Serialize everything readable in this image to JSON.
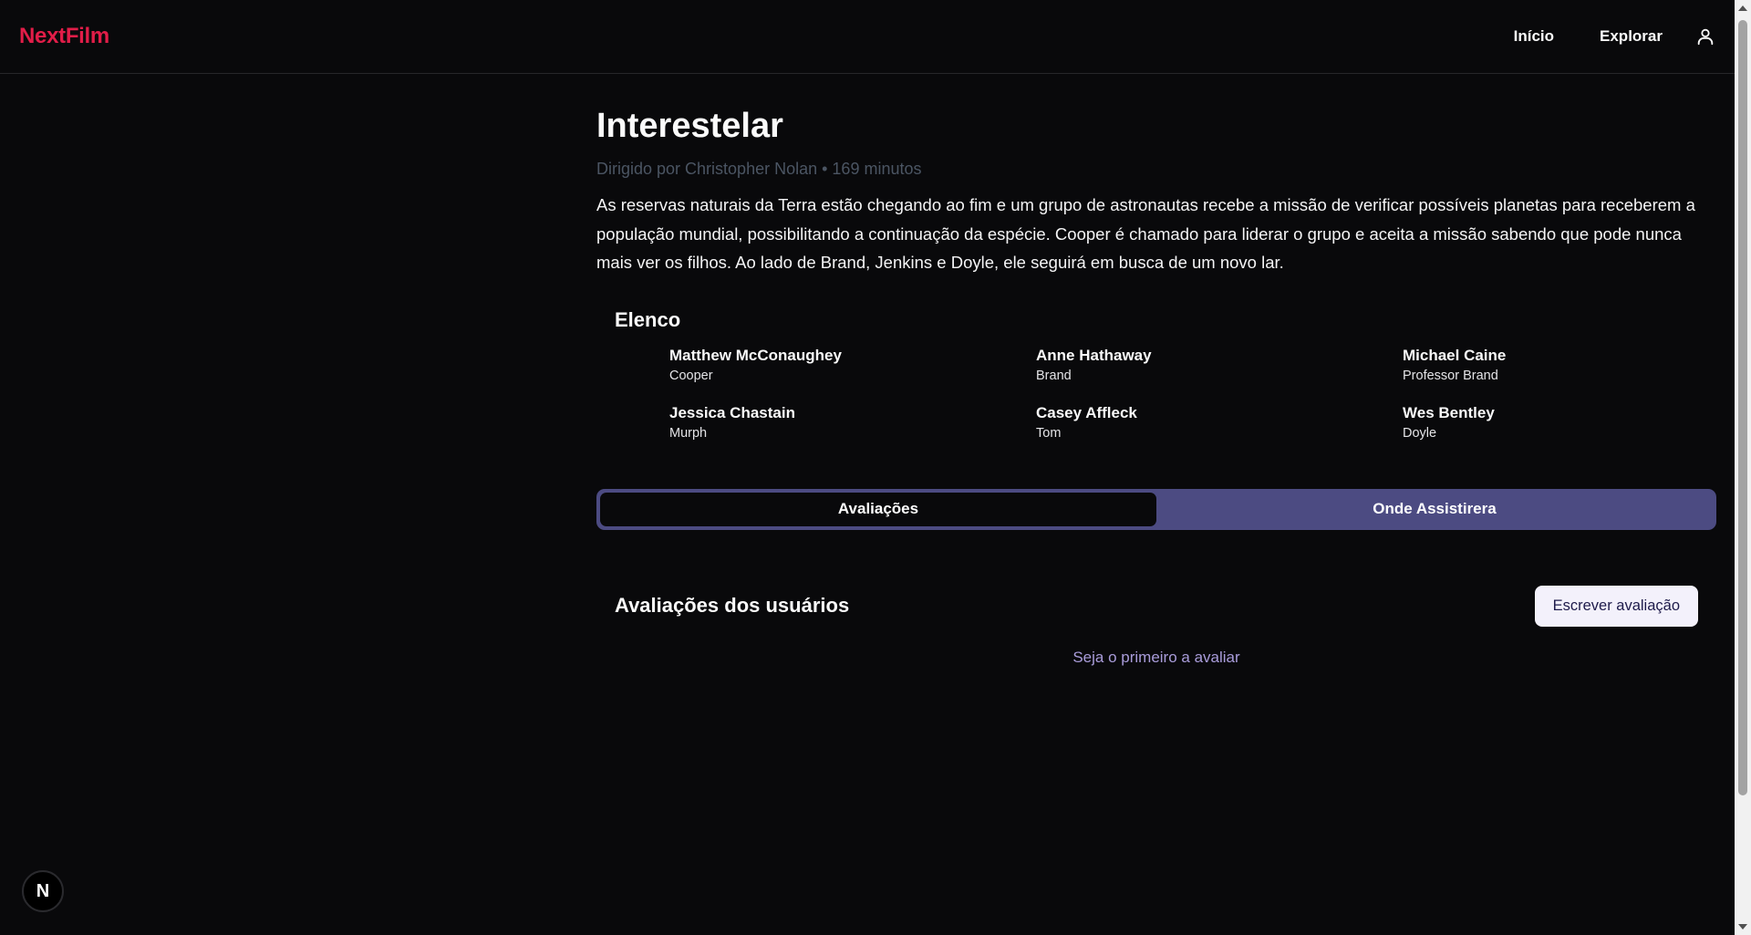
{
  "header": {
    "logo": "NextFilm",
    "nav": [
      {
        "label": "Início"
      },
      {
        "label": "Explorar"
      }
    ],
    "user_icon": "user-icon"
  },
  "movie": {
    "title": "Interestelar",
    "subtitle": "Dirigido por Christopher Nolan • 169 minutos",
    "synopsis": "As reservas naturais da Terra estão chegando ao fim e um grupo de astronautas recebe a missão de verificar possíveis planetas para receberem a população mundial, possibilitando a continuação da espécie. Cooper é chamado para liderar o grupo e aceita a missão sabendo que pode nunca mais ver os filhos. Ao lado de Brand, Jenkins e Doyle, ele seguirá em busca de um novo lar."
  },
  "cast": {
    "title": "Elenco",
    "members": [
      {
        "name": "Matthew McConaughey",
        "role": "Cooper"
      },
      {
        "name": "Anne Hathaway",
        "role": "Brand"
      },
      {
        "name": "Michael Caine",
        "role": "Professor Brand"
      },
      {
        "name": "Jessica Chastain",
        "role": "Murph"
      },
      {
        "name": "Casey Affleck",
        "role": "Tom"
      },
      {
        "name": "Wes Bentley",
        "role": "Doyle"
      }
    ]
  },
  "tabs": [
    {
      "label": "Avaliações",
      "active": true
    },
    {
      "label": "Onde Assistirera",
      "active": false
    }
  ],
  "reviews": {
    "title": "Avaliações dos usuários",
    "write_button": "Escrever avaliação",
    "empty_message": "Seja o primeiro a avaliar"
  },
  "badge": {
    "label": "N"
  },
  "colors": {
    "background": "#09090b",
    "brand": "#e11d48",
    "tabs_bg": "#4c4b82",
    "button_bg": "#f3f1fb"
  }
}
